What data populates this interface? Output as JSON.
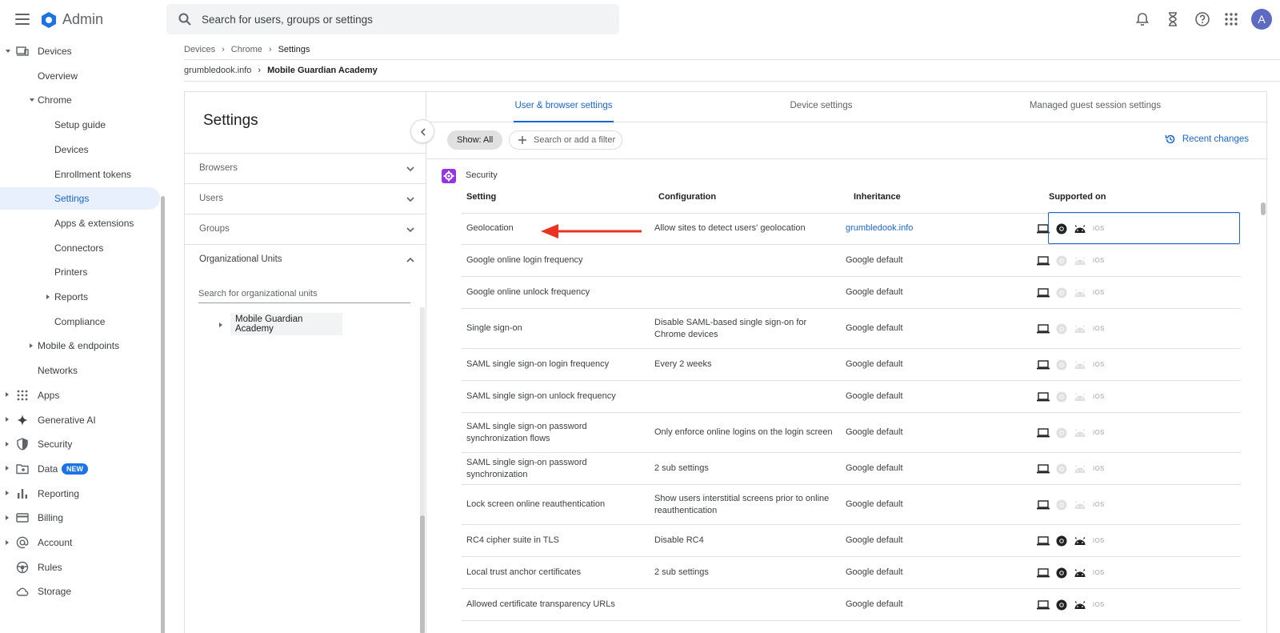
{
  "header": {
    "app_name": "Admin",
    "search_placeholder": "Search for users, groups or settings",
    "avatar_letter": "A"
  },
  "nav": {
    "items": [
      {
        "label": "Devices",
        "level": 0,
        "caret": "down",
        "icon": "devices-icon"
      },
      {
        "label": "Overview",
        "level": 1
      },
      {
        "label": "Chrome",
        "level": 1,
        "caret": "down"
      },
      {
        "label": "Setup guide",
        "level": 2
      },
      {
        "label": "Devices",
        "level": 2
      },
      {
        "label": "Enrollment tokens",
        "level": 2
      },
      {
        "label": "Settings",
        "level": 2,
        "active": true
      },
      {
        "label": "Apps & extensions",
        "level": 2
      },
      {
        "label": "Connectors",
        "level": 2
      },
      {
        "label": "Printers",
        "level": 2
      },
      {
        "label": "Reports",
        "level": 2,
        "caret": "right"
      },
      {
        "label": "Compliance",
        "level": 2
      },
      {
        "label": "Mobile & endpoints",
        "level": 1,
        "caret": "right"
      },
      {
        "label": "Networks",
        "level": 1
      },
      {
        "label": "Apps",
        "level": 0,
        "caret": "right",
        "icon": "apps-grid-icon"
      },
      {
        "label": "Generative AI",
        "level": 0,
        "caret": "right",
        "icon": "sparkle-icon"
      },
      {
        "label": "Security",
        "level": 0,
        "caret": "right",
        "icon": "shield-icon"
      },
      {
        "label": "Data",
        "level": 0,
        "caret": "right",
        "icon": "data-folder-icon",
        "badge": "NEW"
      },
      {
        "label": "Reporting",
        "level": 0,
        "caret": "right",
        "icon": "bar-chart-icon"
      },
      {
        "label": "Billing",
        "level": 0,
        "caret": "right",
        "icon": "credit-card-icon"
      },
      {
        "label": "Account",
        "level": 0,
        "caret": "right",
        "icon": "at-sign-icon"
      },
      {
        "label": "Rules",
        "level": 0,
        "icon": "rules-icon"
      },
      {
        "label": "Storage",
        "level": 0,
        "icon": "cloud-icon"
      }
    ]
  },
  "breadcrumbs": [
    "Devices",
    "Chrome",
    "Settings"
  ],
  "org_breadcrumbs": [
    "grumbledook.info",
    "Mobile Guardian Academy"
  ],
  "side_panel": {
    "title": "Settings",
    "accordions": [
      "Browsers",
      "Users",
      "Groups",
      "Organizational Units"
    ],
    "ou_search_placeholder": "Search for organizational units",
    "ou_node": "Mobile Guardian Academy"
  },
  "tabs": [
    "User & browser settings",
    "Device settings",
    "Managed guest session settings"
  ],
  "toolbar": {
    "show_chip": "Show: All",
    "filter_placeholder": "Search or add a filter",
    "recent_changes": "Recent changes"
  },
  "section": {
    "title": "Security",
    "columns": [
      "Setting",
      "Configuration",
      "Inheritance",
      "Supported on"
    ]
  },
  "rows": [
    {
      "setting": "Geolocation",
      "configuration": "Allow sites to detect users' geolocation",
      "inheritance": "grumbledook.info",
      "inherit_link": true,
      "platforms": [
        1,
        1,
        1,
        0
      ]
    },
    {
      "setting": "Google online login frequency",
      "configuration": "",
      "inheritance": "Google default",
      "platforms": [
        1,
        0,
        0,
        0
      ]
    },
    {
      "setting": "Google online unlock frequency",
      "configuration": "",
      "inheritance": "Google default",
      "platforms": [
        1,
        0,
        0,
        0
      ]
    },
    {
      "setting": "Single sign-on",
      "configuration": "Disable SAML-based single sign-on for Chrome devices",
      "inheritance": "Google default",
      "platforms": [
        1,
        0,
        0,
        0
      ]
    },
    {
      "setting": "SAML single sign-on login frequency",
      "configuration": "Every 2 weeks",
      "inheritance": "Google default",
      "platforms": [
        1,
        0,
        0,
        0
      ]
    },
    {
      "setting": "SAML single sign-on unlock frequency",
      "configuration": "",
      "inheritance": "Google default",
      "platforms": [
        1,
        0,
        0,
        0
      ]
    },
    {
      "setting": "SAML single sign-on password synchronization flows",
      "configuration": "Only enforce online logins on the login screen",
      "inheritance": "Google default",
      "platforms": [
        1,
        0,
        0,
        0
      ]
    },
    {
      "setting": "SAML single sign-on password synchronization",
      "configuration": "2 sub settings",
      "inheritance": "Google default",
      "platforms": [
        1,
        0,
        0,
        0
      ]
    },
    {
      "setting": "Lock screen online reauthentication",
      "configuration": "Show users interstitial screens prior to online reauthentication",
      "inheritance": "Google default",
      "platforms": [
        1,
        0,
        0,
        0
      ]
    },
    {
      "setting": "RC4 cipher suite in TLS",
      "configuration": "Disable RC4",
      "inheritance": "Google default",
      "platforms": [
        1,
        1,
        1,
        0
      ]
    },
    {
      "setting": "Local trust anchor certificates",
      "configuration": "2 sub settings",
      "inheritance": "Google default",
      "platforms": [
        1,
        1,
        1,
        0
      ]
    },
    {
      "setting": "Allowed certificate transparency URLs",
      "configuration": "",
      "inheritance": "Google default",
      "platforms": [
        1,
        1,
        1,
        0
      ]
    }
  ],
  "ios_label": "iOS",
  "colors": {
    "accent": "#1967d2",
    "annotation_arrow": "#ea3323",
    "section_icon": "#9334e6"
  }
}
